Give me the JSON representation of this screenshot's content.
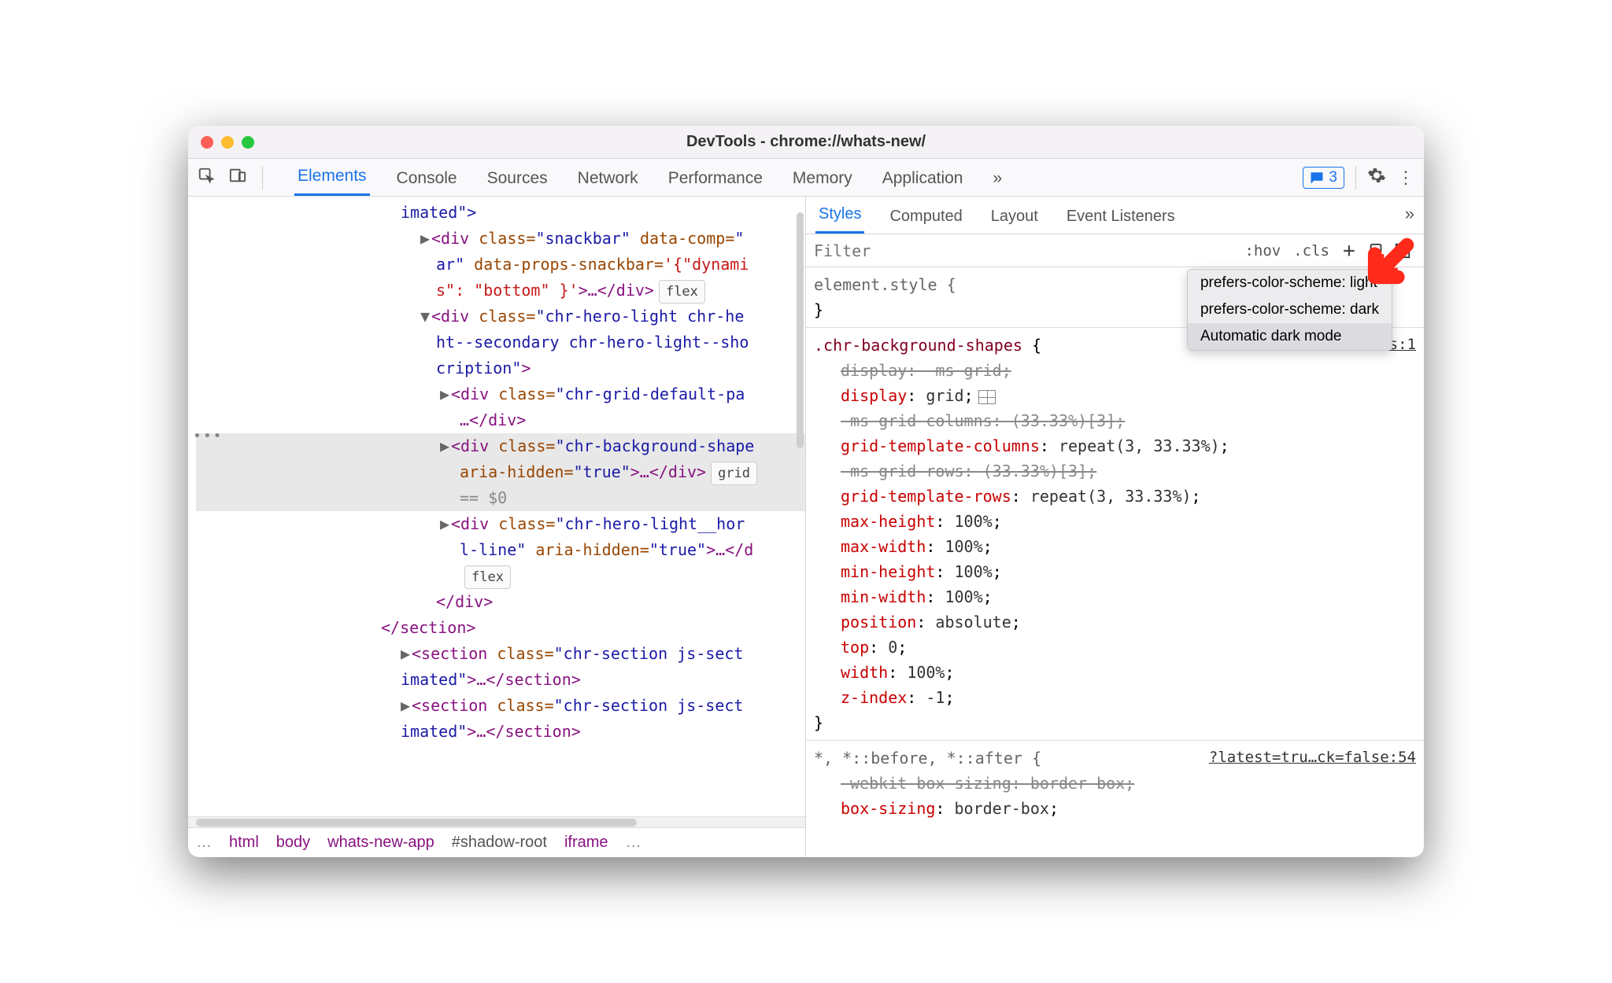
{
  "window_title": "DevTools - chrome://whats-new/",
  "main_tabs": [
    "Elements",
    "Console",
    "Sources",
    "Network",
    "Performance",
    "Memory",
    "Application"
  ],
  "main_tab_active": 0,
  "feedback_count": "3",
  "sub_tabs": [
    "Styles",
    "Computed",
    "Layout",
    "Event Listeners"
  ],
  "sub_tab_active": 0,
  "filter_placeholder": "Filter",
  "filter_buttons": {
    "hov": ":hov",
    "cls": ".cls"
  },
  "dom": {
    "l0": "imated\">",
    "l1_a": "<div",
    "l1_b": "class=",
    "l1_c": "\"snackbar\"",
    "l1_d": "data-comp=",
    "l1_e": "\"",
    "l2_a": "ar\"",
    "l2_b": "data-props-snackbar=",
    "l2_c": "'{\"dynami",
    "l3_a": "s\": \"bottom\" }'",
    "l3_b": ">…</div>",
    "l3_badge": "flex",
    "l4_a": "<div",
    "l4_b": "class=",
    "l4_c": "\"chr-hero-light chr-he",
    "l5": "ht--secondary chr-hero-light--sho",
    "l6_a": "cription\"",
    "l6_b": ">",
    "l7_a": "<div",
    "l7_b": "class=",
    "l7_c": "\"chr-grid-default-pa",
    "l8": "…</div>",
    "l9_a": "<div",
    "l9_b": "class=",
    "l9_c": "\"chr-background-shape",
    "l10_a": "aria-hidden=",
    "l10_b": "\"true\"",
    "l10_c": ">…</div>",
    "l10_badge": "grid",
    "l11": " == $0",
    "l12_a": "<div",
    "l12_b": "class=",
    "l12_c": "\"chr-hero-light__hor",
    "l13_a": "l-line\"",
    "l13_b": "aria-hidden=",
    "l13_c": "\"true\"",
    "l13_d": ">…</d",
    "l14_badge": "flex",
    "l15": "</div>",
    "l16": "</section>",
    "l17_a": "<section",
    "l17_b": "class=",
    "l17_c": "\"chr-section js-sect",
    "l18_a": "imated\"",
    "l18_b": ">…</section>",
    "l19_a": "<section",
    "l19_b": "class=",
    "l19_c": "\"chr-section js-sect",
    "l20_a": "imated\"",
    "l20_b": ">…</section>"
  },
  "breadcrumbs": [
    "html",
    "body",
    "whats-new-app",
    "#shadow-root",
    "iframe"
  ],
  "styles": {
    "element_style_open": "element.style {",
    "close": "}",
    "rule_selector": ".chr-background-shapes",
    "rule_src": "n.css:1",
    "props": [
      {
        "p": "display",
        "v": "-ms-grid",
        "struck": true
      },
      {
        "p": "display",
        "v": "grid",
        "grid_icon": true
      },
      {
        "p": "-ms-grid-columns",
        "v": "(33.33%)[3]",
        "struck": true
      },
      {
        "p": "grid-template-columns",
        "v": "repeat(3, 33.33%)"
      },
      {
        "p": "-ms-grid-rows",
        "v": "(33.33%)[3]",
        "struck": true
      },
      {
        "p": "grid-template-rows",
        "v": "repeat(3, 33.33%)"
      },
      {
        "p": "max-height",
        "v": "100%"
      },
      {
        "p": "max-width",
        "v": "100%"
      },
      {
        "p": "min-height",
        "v": "100%"
      },
      {
        "p": "min-width",
        "v": "100%"
      },
      {
        "p": "position",
        "v": "absolute"
      },
      {
        "p": "top",
        "v": "0"
      },
      {
        "p": "width",
        "v": "100%"
      },
      {
        "p": "z-index",
        "v": "-1"
      }
    ],
    "ua_selector": "*, *::before, *::after {",
    "ua_src": "?latest=tru…ck=false:54",
    "ua_props": [
      {
        "p": "-webkit-box-sizing",
        "v": "border-box",
        "struck": true
      },
      {
        "p": "box-sizing",
        "v": "border-box"
      }
    ]
  },
  "popup": {
    "items": [
      "prefers-color-scheme: light",
      "prefers-color-scheme: dark",
      "Automatic dark mode"
    ],
    "active_index": 2
  }
}
